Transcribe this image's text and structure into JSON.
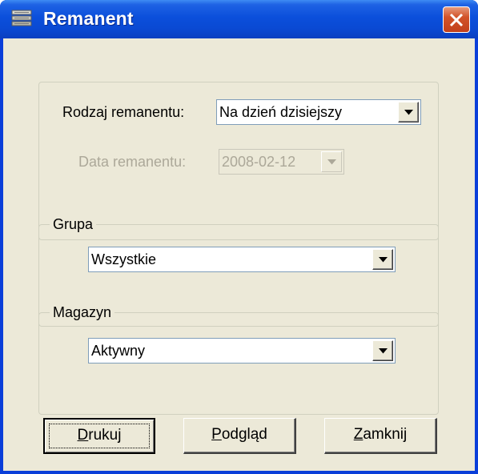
{
  "window": {
    "title": "Remanent",
    "icon": "database-stack-icon"
  },
  "remanent_type": {
    "label": "Rodzaj remanentu:",
    "value": "Na dzień dzisiejszy"
  },
  "remanent_date": {
    "label": "Data remanentu:",
    "value": "2008-02-12",
    "enabled": false
  },
  "group": {
    "label": "Grupa",
    "value": "Wszystkie"
  },
  "warehouse": {
    "label": "Magazyn",
    "value": "Aktywny"
  },
  "buttons": {
    "print": {
      "mnemonic": "D",
      "rest": "rukuj"
    },
    "preview": {
      "mnemonic": "P",
      "rest": "odgląd"
    },
    "close": {
      "mnemonic": "Z",
      "rest": "amknij"
    }
  },
  "colors": {
    "title_bar": "#0a4fdb",
    "close_button": "#d2532a",
    "dialog_bg": "#ece9d8",
    "disabled_text": "#aca899"
  }
}
